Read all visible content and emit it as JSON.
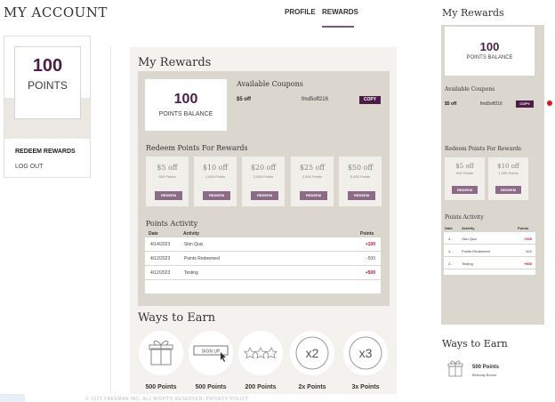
{
  "header": {
    "title": "MY ACCOUNT",
    "nav": [
      {
        "label": "PROFILE",
        "active": false
      },
      {
        "label": "REWARDS",
        "active": true
      }
    ]
  },
  "sidebar": {
    "points_value": "100",
    "points_label": "POINTS",
    "links": [
      "REDEEM REWARDS",
      "LOG OUT"
    ]
  },
  "rewards": {
    "title": "My Rewards",
    "balance_value": "100",
    "balance_label": "POINTS BALANCE",
    "coupons_title": "Available Coupons",
    "coupon": {
      "amount": "$5 off",
      "code": "fmd5off216",
      "copy_label": "COPY"
    },
    "redeem_title": "Redeem Points For Rewards",
    "redeem_options": [
      {
        "amount": "$5 off",
        "points": "500 Points",
        "button": "REDEEM"
      },
      {
        "amount": "$10 off",
        "points": "1,000 Points",
        "button": "REDEEM"
      },
      {
        "amount": "$20 off",
        "points": "2,000 Points",
        "button": "REDEEM"
      },
      {
        "amount": "$25 off",
        "points": "2,500 Points",
        "button": "REDEEM"
      },
      {
        "amount": "$50 off",
        "points": "5,000 Points",
        "button": "REDEEM"
      }
    ],
    "activity_title": "Points Activity",
    "activity_columns": {
      "date": "Date",
      "activity": "Activity",
      "points": "Points"
    },
    "activity_rows": [
      {
        "date": "4/14/2023",
        "activity": "Skin Quiz",
        "points": "+100",
        "color": "#b3123a"
      },
      {
        "date": "4/12/2023",
        "activity": "Points Redeemed",
        "points": "-500",
        "color": "#555555"
      },
      {
        "date": "4/12/2023",
        "activity": "Testing",
        "points": "+500",
        "color": "#b3123a"
      }
    ]
  },
  "earn": {
    "title": "Ways to Earn",
    "items": [
      {
        "icon": "gift-icon",
        "label": "500 Points"
      },
      {
        "icon": "signup-icon",
        "icon_text": "SIGN UP",
        "label": "500 Points"
      },
      {
        "icon": "stars-icon",
        "label": "200 Points"
      },
      {
        "icon": "2x-icon",
        "icon_text": "x2",
        "label": "2x Points"
      },
      {
        "icon": "3x-icon",
        "icon_text": "x3",
        "label": "3x Points"
      }
    ]
  },
  "mobile": {
    "title": "My Rewards",
    "balance_value": "100",
    "balance_label": "POINTS BALANCE",
    "coupons_title": "Available Coupons",
    "coupon": {
      "amount": "$5 off",
      "code": "fmd5off216",
      "copy_label": "COPY"
    },
    "redeem_title": "Redeem Points For Rewards",
    "redeem_options": [
      {
        "amount": "$5 off",
        "points": "500 Points",
        "button": "REDEEM"
      },
      {
        "amount": "$10 off",
        "points": "1,000 Points",
        "button": "REDEEM"
      }
    ],
    "activity_title": "Points Activity",
    "activity_columns": {
      "date": "Date",
      "activity": "Activity",
      "points": "Points"
    },
    "activity_rows": [
      {
        "date": "4...",
        "activity": "Skin Quiz",
        "points": "+100"
      },
      {
        "date": "4...",
        "activity": "Points Redeemed",
        "points": "-500"
      },
      {
        "date": "4...",
        "activity": "Testing",
        "points": "+500"
      }
    ],
    "earn_title": "Ways to Earn",
    "earn_item": {
      "label": "500 Points",
      "desc": "Birthday Bonus"
    }
  },
  "colors": {
    "brand": "#4b1d47",
    "button": "#8d6a88",
    "panel": "#dbd7cf",
    "positive": "#b3123a"
  },
  "footer": {
    "text": "© 2023 FREEMAN INC. ALL RIGHTS RESERVED. PRIVACY POLICY"
  }
}
